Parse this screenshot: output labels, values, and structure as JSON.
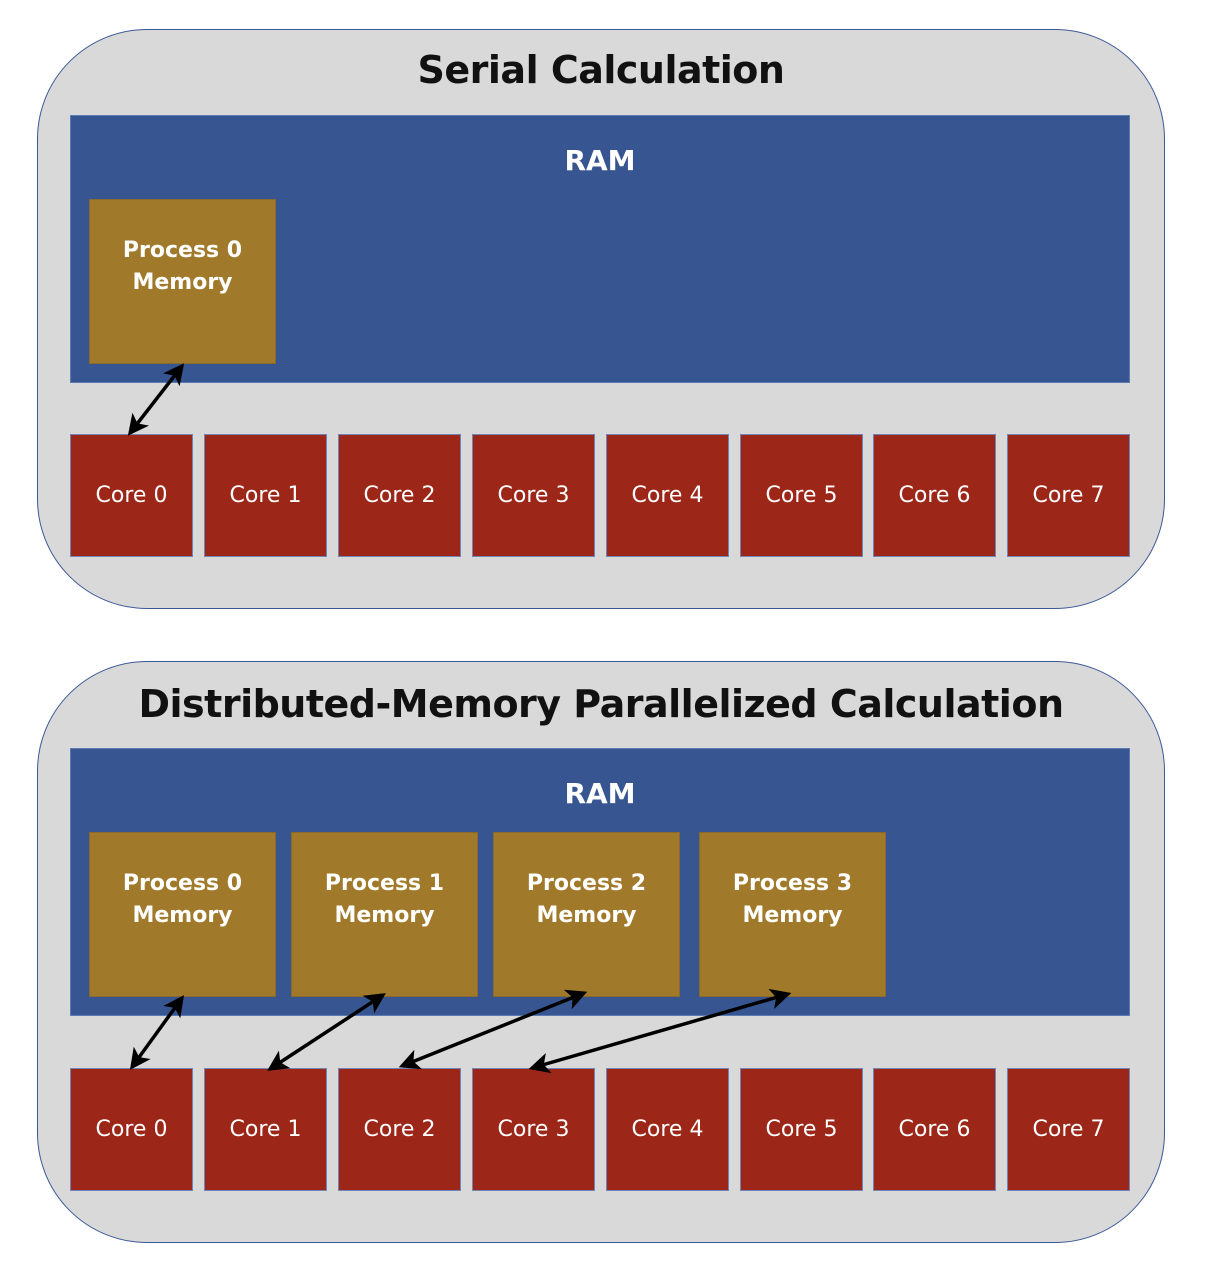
{
  "serial": {
    "title": "Serial Calculation",
    "ram_label": "RAM",
    "processes": [
      {
        "line1": "Process 0",
        "line2": "Memory"
      }
    ],
    "cores": [
      "Core 0",
      "Core 1",
      "Core 2",
      "Core 3",
      "Core 4",
      "Core 5",
      "Core 6",
      "Core 7"
    ],
    "links": [
      {
        "process": 0,
        "core": 0
      }
    ]
  },
  "distributed": {
    "title": "Distributed-Memory Parallelized Calculation",
    "ram_label": "RAM",
    "processes": [
      {
        "line1": "Process 0",
        "line2": "Memory"
      },
      {
        "line1": "Process 1",
        "line2": "Memory"
      },
      {
        "line1": "Process 2",
        "line2": "Memory"
      },
      {
        "line1": "Process 3",
        "line2": "Memory"
      }
    ],
    "cores": [
      "Core 0",
      "Core 1",
      "Core 2",
      "Core 3",
      "Core 4",
      "Core 5",
      "Core 6",
      "Core 7"
    ],
    "links": [
      {
        "process": 0,
        "core": 0
      },
      {
        "process": 1,
        "core": 1
      },
      {
        "process": 2,
        "core": 2
      },
      {
        "process": 3,
        "core": 3
      }
    ]
  },
  "colors": {
    "panel_bg": "#d9d9d9",
    "ram": "#375591",
    "process_memory": "#a07a2a",
    "core": "#9c2617",
    "arrow": "#000000"
  }
}
